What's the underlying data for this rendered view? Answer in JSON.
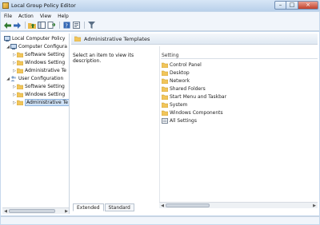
{
  "window": {
    "title": "Local Group Policy Editor"
  },
  "menu": [
    "File",
    "Action",
    "View",
    "Help"
  ],
  "toolbar": {
    "buttons": [
      "back-arrow-icon",
      "forward-arrow-icon",
      "up-folder-icon",
      "show-hide-tree-icon",
      "export-list-icon",
      "help-icon",
      "properties-icon",
      "filter-icon"
    ]
  },
  "tree": {
    "root": "Local Computer Policy",
    "computer_config": "Computer Configura",
    "cc_software": "Software Setting",
    "cc_windows": "Windows Setting",
    "cc_admin": "Administrative Te",
    "user_config": "User Configuration",
    "uc_software": "Software Setting",
    "uc_windows": "Windows Setting",
    "uc_admin": "Administrative Te"
  },
  "right_pane": {
    "header": "Administrative Templates",
    "description": "Select an item to view its description.",
    "column_header": "Setting",
    "items": [
      "Control Panel",
      "Desktop",
      "Network",
      "Shared Folders",
      "Start Menu and Taskbar",
      "System",
      "Windows Components",
      "All Settings"
    ]
  },
  "tabs": {
    "extended": "Extended",
    "standard": "Standard"
  },
  "colors": {
    "folder": "#f1c55b",
    "selection": "#cfe2f7",
    "titlebar": "#c6d8ec"
  }
}
